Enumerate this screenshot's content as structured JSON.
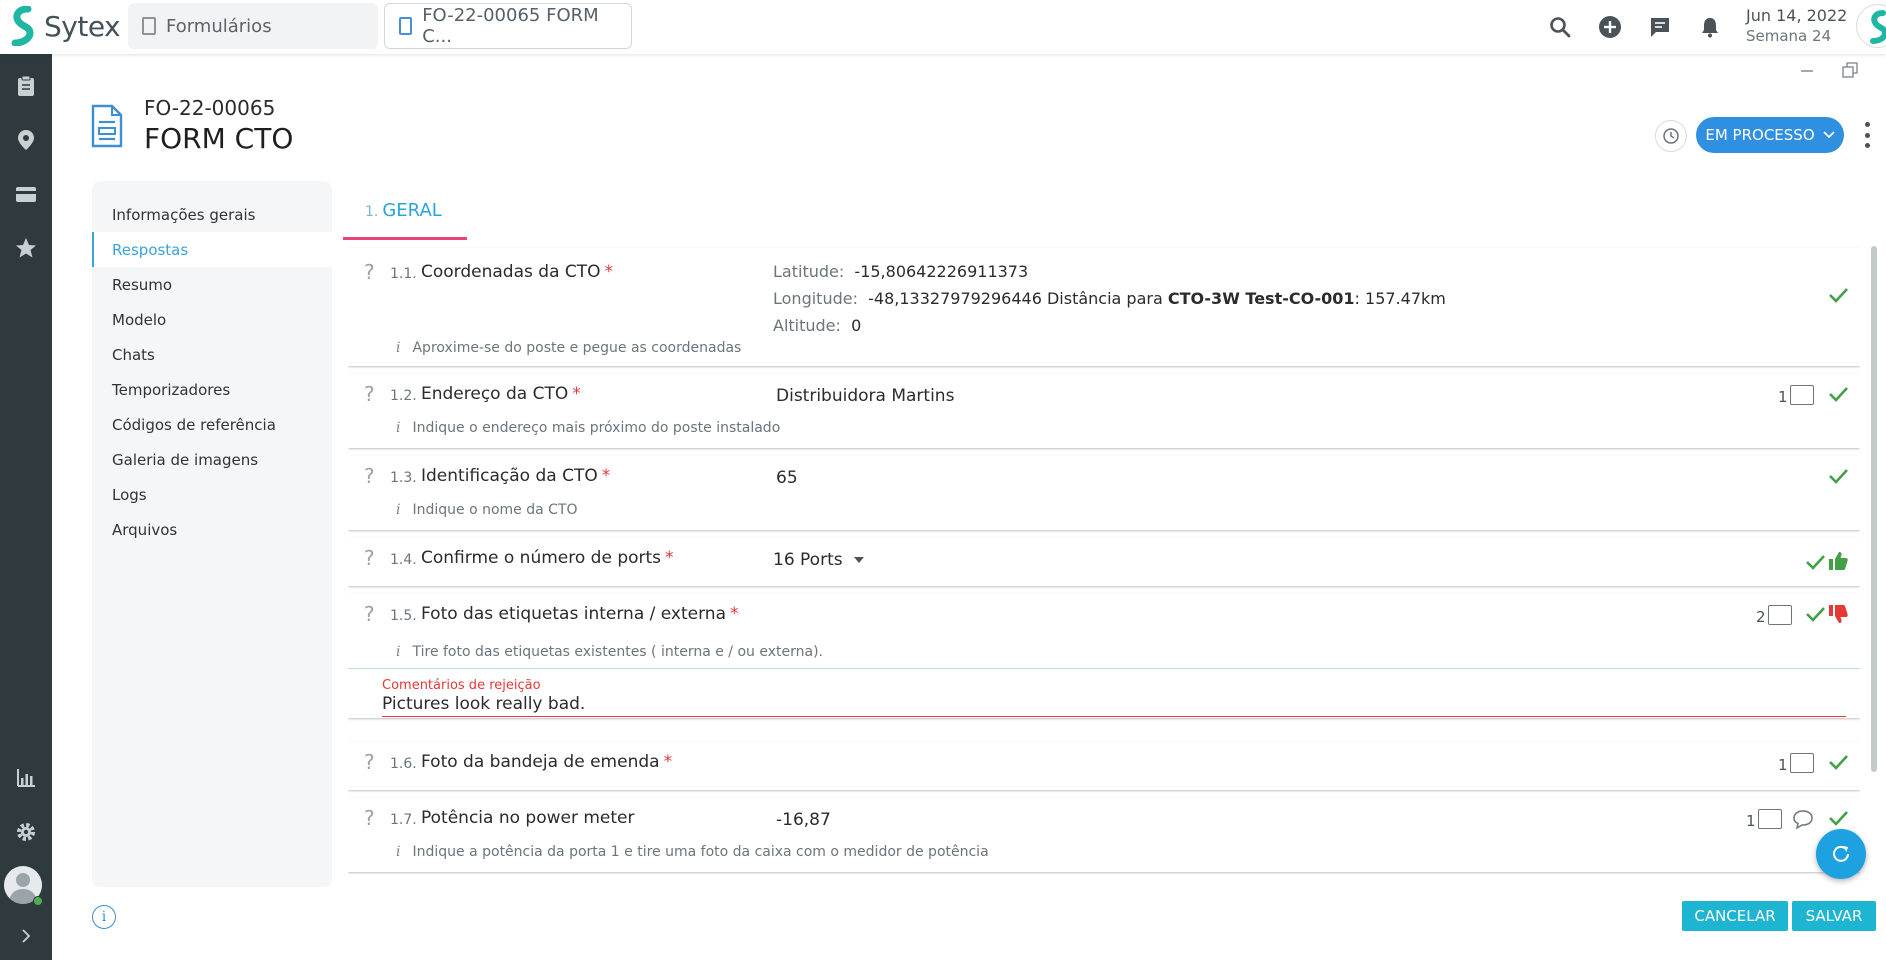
{
  "app": {
    "name": "Sytex"
  },
  "tabs": [
    {
      "label": "Formulários"
    },
    {
      "label": "FO-22-00065 FORM C..."
    }
  ],
  "header": {
    "date": "Jun 14, 2022",
    "week": "Semana 24"
  },
  "form": {
    "code": "FO-22-00065",
    "title": "FORM CTO",
    "status": "EM PROCESSO"
  },
  "menu": {
    "items": [
      {
        "label": "Informações gerais"
      },
      {
        "label": "Respostas"
      },
      {
        "label": "Resumo"
      },
      {
        "label": "Modelo"
      },
      {
        "label": "Chats"
      },
      {
        "label": "Temporizadores"
      },
      {
        "label": "Códigos de referência"
      },
      {
        "label": "Galeria de imagens"
      },
      {
        "label": "Logs"
      },
      {
        "label": "Arquivos"
      }
    ],
    "active": "Respostas"
  },
  "step": {
    "num": "1.",
    "label": "GERAL"
  },
  "questions": {
    "q1": {
      "num": "1.1.",
      "label": "Coordenadas da CTO",
      "req": "*",
      "lat_label": "Latitude:",
      "lat": "-15,80642226911373",
      "lon_label": "Longitude:",
      "lon": "-48,13327979296446",
      "dist_prefix": "Distância para",
      "dist_target": "CTO-3W Test-CO-001",
      "dist_value": ": 157.47km",
      "alt_label": "Altitude:",
      "alt": "0",
      "hint": "Aproxime-se do poste e pegue as coordenadas"
    },
    "q2": {
      "num": "1.2.",
      "label": "Endereço da CTO",
      "req": "*",
      "answer": "Distribuidora Martins",
      "count": "1",
      "hint": "Indique o endereço mais próximo do poste instalado"
    },
    "q3": {
      "num": "1.3.",
      "label": "Identificação da CTO",
      "req": "*",
      "answer": "65",
      "hint": "Indique o nome da CTO"
    },
    "q4": {
      "num": "1.4.",
      "label": "Confirme o número de ports",
      "req": "*",
      "answer": "16 Ports"
    },
    "q5": {
      "num": "1.5.",
      "label": "Foto das etiquetas interna / externa",
      "req": "*",
      "count": "2",
      "hint": "Tire foto das etiquetas existentes ( interna e / ou externa).",
      "reject_label": "Comentários de rejeição",
      "reject_text": "Pictures look really bad."
    },
    "q6": {
      "num": "1.6.",
      "label": "Foto da bandeja de emenda",
      "req": "*",
      "count": "1"
    },
    "q7": {
      "num": "1.7.",
      "label": "Potência no power meter",
      "answer": "-16,87",
      "count": "1",
      "hint": "Indique a potência da porta 1 e tire uma foto da caixa com o medidor de potência"
    }
  },
  "buttons": {
    "cancel": "CANCELAR",
    "save": "SALVAR"
  },
  "colors": {
    "accent": "#2f8fe0",
    "check": "#43a047",
    "reject": "#e53935",
    "tab_underline": "#e8437b",
    "button": "#1eb5d3"
  }
}
